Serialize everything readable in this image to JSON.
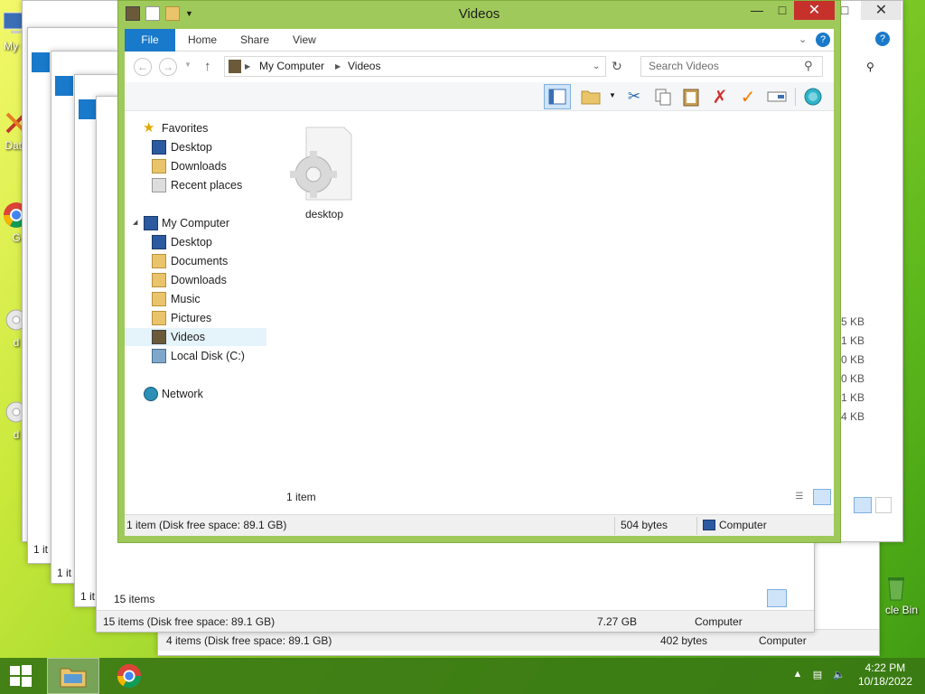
{
  "desktop": {
    "icons": [
      {
        "label": "My C"
      },
      {
        "label": "Data"
      },
      {
        "label": "G"
      },
      {
        "label": "d"
      },
      {
        "label": "d"
      },
      {
        "label": "cle Bin"
      }
    ]
  },
  "bg_windows": {
    "w1": {
      "status_count": "1 it",
      "status_left": "1",
      "size_fragments": [
        "5 KB",
        "1 KB",
        "0 KB",
        "0 KB",
        "1 KB",
        "4 KB"
      ]
    },
    "w2": {
      "status_count": "1 it"
    },
    "w3": {
      "status_count": "1 it"
    },
    "w4": {
      "item_count": "15 items",
      "status_text": "15 items (Disk free space: 89.1 GB)",
      "size": "7.27 GB",
      "location": "Computer"
    },
    "w5": {
      "status_text": "4 items (Disk free space: 89.1 GB)",
      "size": "402 bytes",
      "location": "Computer"
    }
  },
  "window": {
    "title": "Videos",
    "minimize": "—",
    "maximize": "□",
    "close": "✕",
    "tabs": [
      "File",
      "Home",
      "Share",
      "View"
    ],
    "breadcrumb": [
      "My Computer",
      "Videos"
    ],
    "search_placeholder": "Search Videos",
    "nav": {
      "favorites": "Favorites",
      "favorites_items": [
        "Desktop",
        "Downloads",
        "Recent places"
      ],
      "computer": "My Computer",
      "computer_items": [
        "Desktop",
        "Documents",
        "Downloads",
        "Music",
        "Pictures",
        "Videos",
        "Local Disk (C:)"
      ],
      "network": "Network"
    },
    "files": [
      {
        "name": "desktop"
      }
    ],
    "item_count": "1 item",
    "status": {
      "text": "1 item (Disk free space: 89.1 GB)",
      "size": "504 bytes",
      "location": "Computer"
    }
  },
  "taskbar": {
    "time": "4:22 PM",
    "date": "10/18/2022"
  },
  "colors": {
    "accent": "#1979ca",
    "window_frame": "#9fc95a",
    "close_red": "#c7312c"
  }
}
